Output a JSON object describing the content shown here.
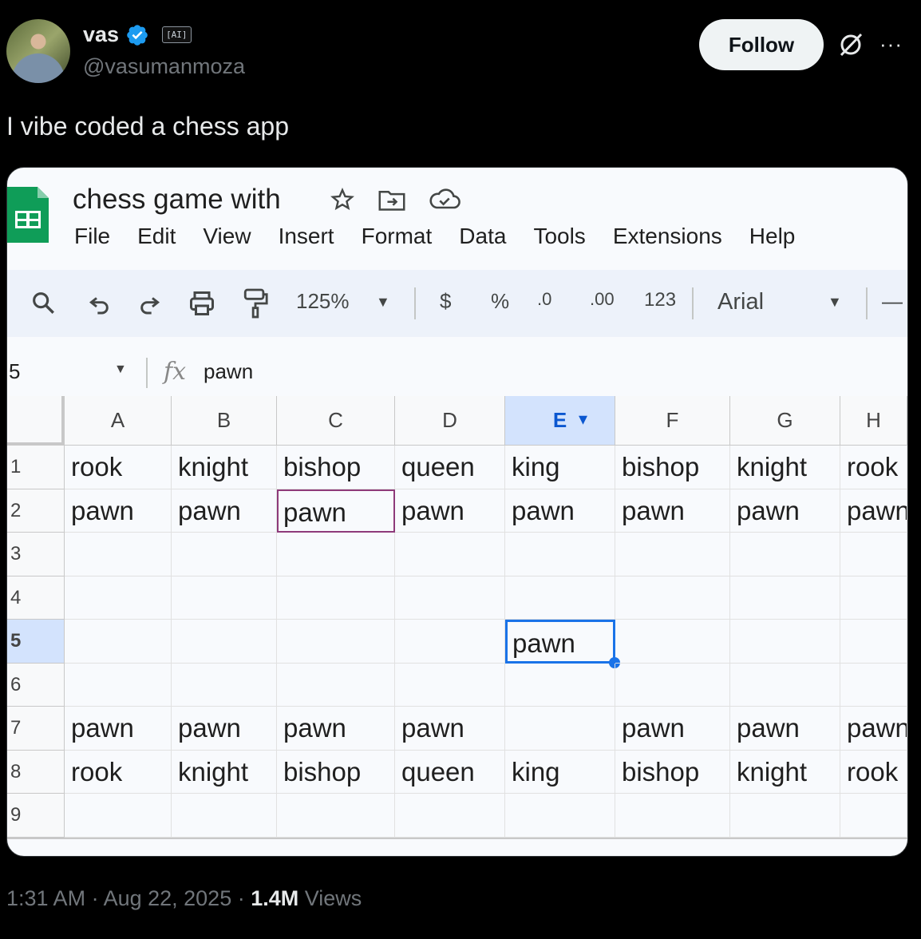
{
  "author": {
    "name": "vas",
    "badge": "[AI]",
    "handle": "@vasumanmoza",
    "avatar_icon": "profile-photo"
  },
  "follow_label": "Follow",
  "more_label": "···",
  "tweet_text": "I vibe coded a chess app",
  "footer": {
    "time": "1:31 AM · Aug 22, 2025 · ",
    "views_count": "1.4M",
    "views_label": " Views"
  },
  "sheet": {
    "title": "chess game with",
    "menu": [
      "File",
      "Edit",
      "View",
      "Insert",
      "Format",
      "Data",
      "Tools",
      "Extensions",
      "Help"
    ],
    "toolbar": {
      "zoom": "125%",
      "currency": "$",
      "percent": "%",
      "dec_decrease": ".0",
      "dec_increase": ".00",
      "number_format": "123",
      "font": "Arial",
      "minus": "—"
    },
    "name_box": "5",
    "fx_label": "fx",
    "formula": "pawn",
    "columns": [
      "A",
      "B",
      "C",
      "D",
      "E",
      "F",
      "G",
      "H"
    ],
    "selected_column": "E",
    "rows": [
      {
        "num": "1",
        "cells": [
          "rook",
          "knight",
          "bishop",
          "queen",
          "king",
          "bishop",
          "knight",
          "rook"
        ]
      },
      {
        "num": "2",
        "cells": [
          "pawn",
          "pawn",
          "pawn",
          "pawn",
          "pawn",
          "pawn",
          "pawn",
          "pawn"
        ]
      },
      {
        "num": "3",
        "cells": [
          "",
          "",
          "",
          "",
          "",
          "",
          "",
          ""
        ]
      },
      {
        "num": "4",
        "cells": [
          "",
          "",
          "",
          "",
          "",
          "",
          "",
          ""
        ]
      },
      {
        "num": "5",
        "cells": [
          "",
          "",
          "",
          "",
          "pawn",
          "",
          "",
          ""
        ]
      },
      {
        "num": "6",
        "cells": [
          "",
          "",
          "",
          "",
          "",
          "",
          "",
          ""
        ]
      },
      {
        "num": "7",
        "cells": [
          "pawn",
          "pawn",
          "pawn",
          "pawn",
          "",
          "pawn",
          "pawn",
          "pawn"
        ]
      },
      {
        "num": "8",
        "cells": [
          "rook",
          "knight",
          "bishop",
          "queen",
          "king",
          "bishop",
          "knight",
          "rook"
        ]
      },
      {
        "num": "9",
        "cells": [
          "",
          "",
          "",
          "",
          "",
          "",
          "",
          ""
        ]
      }
    ],
    "colors": {
      "selected_header": "#d3e3fd",
      "active_cell_border": "#1a73e8",
      "highlight_cell_border": "#8e3a7a",
      "sheets_green": "#0f9d58"
    }
  }
}
